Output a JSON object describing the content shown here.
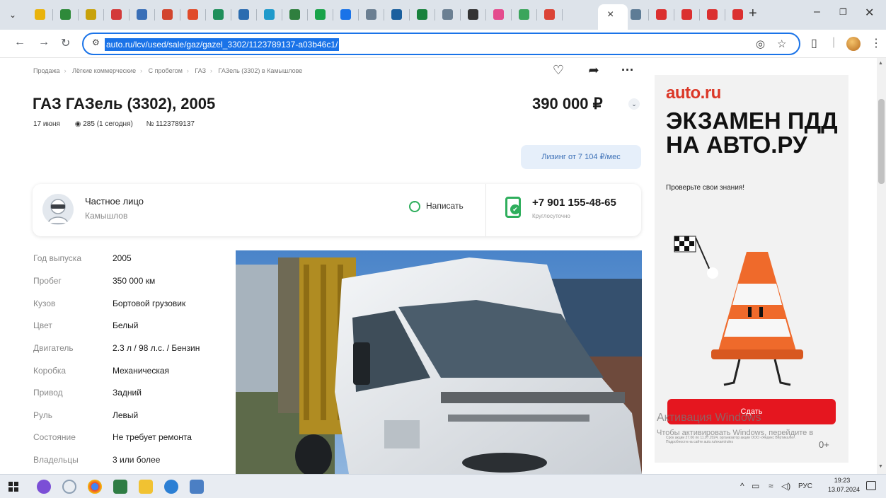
{
  "browser": {
    "url": "auto.ru/lcv/used/sale/gaz/gazel_3302/1123789137-a03b46c1/",
    "active_tab_close": "×",
    "new_tab": "+",
    "tab_colors": [
      "#e9b30c",
      "#2e8a3a",
      "#c8a20b",
      "#d33a3a",
      "#3a6fb7",
      "#d2452e",
      "#e04b2a",
      "#1f8f5b",
      "#2b6cb0",
      "#1f9acb",
      "#2f7f3e",
      "#19a34a",
      "#1a73e8",
      "#6b7f92",
      "#1a5f9e",
      "#17813c",
      "#6b7f92",
      "#333333",
      "#e44c8e",
      "#3ba55c",
      "#db4437",
      "#5e7c96",
      "#db3030",
      "#db3030",
      "#db3030",
      "#db3030",
      "#db3030"
    ]
  },
  "page": {
    "breadcrumb": [
      "Продажа",
      "Лёгкие коммерческие",
      "С пробегом",
      "ГАЗ",
      "ГАЗель (3302) в Камышлове"
    ],
    "breadcrumb_sep": "›",
    "title": "ГАЗ ГАЗель (3302), 2005",
    "price": "390 000 ₽",
    "date": "17 июня",
    "views": "285 (1 сегодня)",
    "listing_no": "№ 1123789137",
    "leasing": "Лизинг от 7 104 ₽/мес",
    "seller": {
      "name": "Частное лицо",
      "city": "Камышлов",
      "write_label": "Написать",
      "phone": "+7 901 155-48-65",
      "phone_sub": "Круглосуточно"
    },
    "specs": [
      {
        "label": "Год выпуска",
        "value": "2005"
      },
      {
        "label": "Пробег",
        "value": "350 000 км"
      },
      {
        "label": "Кузов",
        "value": "Бортовой грузовик"
      },
      {
        "label": "Цвет",
        "value": "Белый"
      },
      {
        "label": "Двигатель",
        "value": "2.3 л / 98 л.с. / Бензин"
      },
      {
        "label": "Коробка",
        "value": "Механическая"
      },
      {
        "label": "Привод",
        "value": "Задний"
      },
      {
        "label": "Руль",
        "value": "Левый"
      },
      {
        "label": "Состояние",
        "value": "Не требует ремонта"
      },
      {
        "label": "Владельцы",
        "value": "3 или более"
      }
    ]
  },
  "ad": {
    "brand": "auto.ru",
    "headline": "ЭКЗАМЕН ПДД НА АВТО.РУ",
    "subtitle": "Проверьте свои знания!",
    "cta": "Сдать",
    "fine_print": "Срок акции 27.06 по 11.07.2024, организатор акции ООО «Яндекс Вертикали». Подробности на сайте auto.ru/exam/rules",
    "age": "0+"
  },
  "watermark": {
    "line1": "Активация Windows",
    "line2": "Чтобы активировать Windows, перейдите в"
  },
  "taskbar": {
    "lang": "РУС",
    "time": "19:23",
    "date": "13.07.2024"
  }
}
